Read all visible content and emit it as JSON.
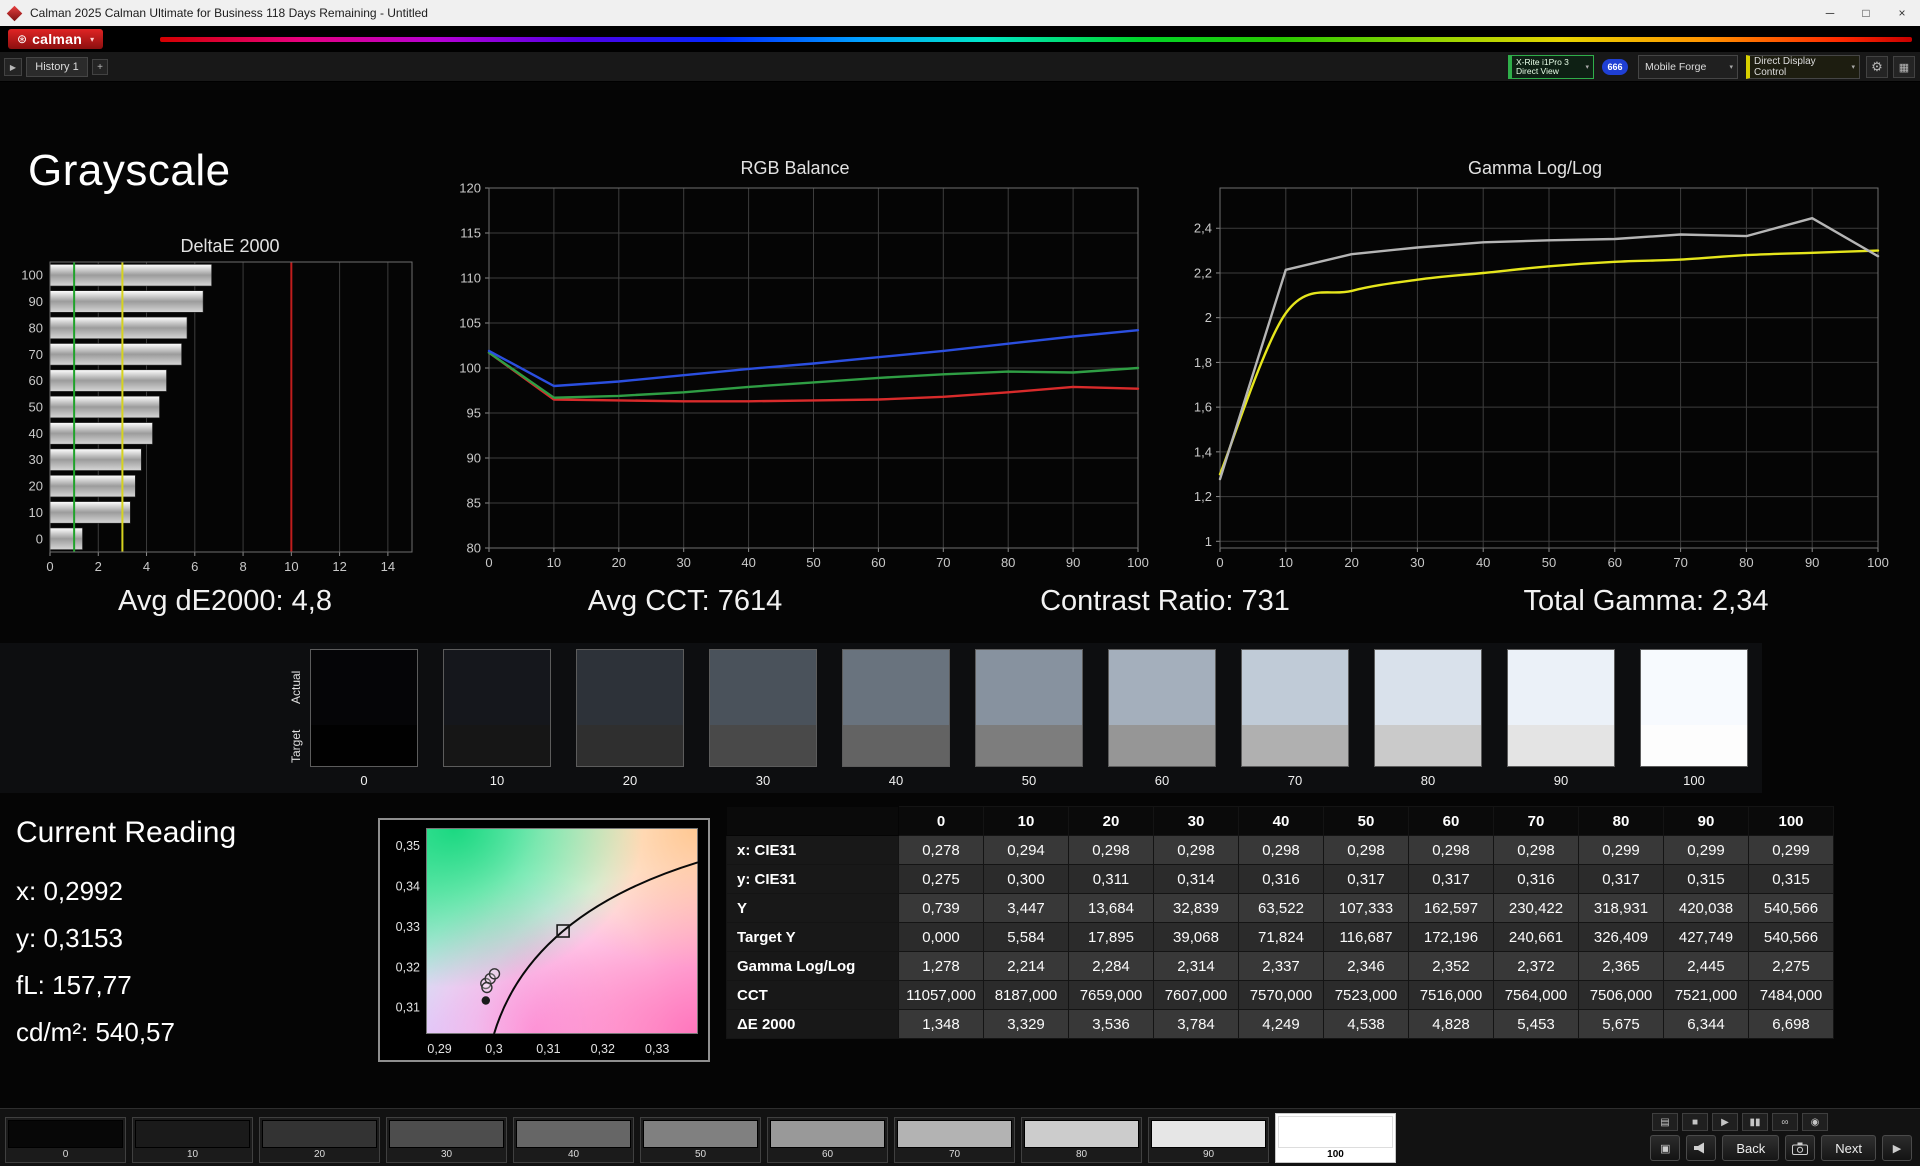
{
  "window": {
    "title": "Calman 2025 Calman Ultimate for Business 118 Days Remaining  - Untitled",
    "minimize_glyph": "─",
    "maximize_glyph": "□",
    "close_glyph": "×"
  },
  "brand": {
    "logo_text": "calman",
    "flower_glyph": "⊛",
    "caret_glyph": "▾",
    "accent_red": "#c41616"
  },
  "toolbar": {
    "expand_glyph": "▶",
    "history_tab": "History 1",
    "add_glyph": "+",
    "meter": {
      "line1": "X-Rite i1Pro 3",
      "line2": "Direct View",
      "accent": "#2fae4a"
    },
    "badge": "666",
    "badge_color": "#1f3fd4",
    "source": "Mobile Forge",
    "display_control": {
      "label": "Direct Display Control",
      "accent": "#d8d000"
    },
    "caret_glyph": "▾",
    "gear_glyph": "⚙",
    "panel_glyph": "▦"
  },
  "page": {
    "title": "Grayscale"
  },
  "summary": {
    "avg_de": "Avg dE2000: 4,8",
    "avg_cct": "Avg CCT: 7614",
    "contrast": "Contrast Ratio: 731",
    "total_gamma": "Total Gamma: 2,34"
  },
  "current_reading": {
    "title": "Current Reading",
    "items": [
      "x: 0,2992",
      "y: 0,3153",
      "fL: 157,77",
      "cd/m²: 540,57"
    ]
  },
  "swatch_strip": {
    "row_labels": [
      "Actual",
      "Target"
    ],
    "levels": [
      "0",
      "10",
      "20",
      "30",
      "40",
      "50",
      "60",
      "70",
      "80",
      "90",
      "100"
    ],
    "actual_colors": [
      "#050507",
      "#15171c",
      "#2d3239",
      "#4a525b",
      "#69737e",
      "#87929f",
      "#a4afbc",
      "#c0cbd7",
      "#d9e1eb",
      "#ebf1f8",
      "#f7fafe"
    ],
    "target_colors": [
      "#010101",
      "#161616",
      "#2f2f2f",
      "#494949",
      "#636363",
      "#7d7d7d",
      "#969696",
      "#b0b0b0",
      "#cacaca",
      "#e4e4e4",
      "#fdfdfd"
    ]
  },
  "table": {
    "columns": [
      "0",
      "10",
      "20",
      "30",
      "40",
      "50",
      "60",
      "70",
      "80",
      "90",
      "100"
    ],
    "rows": [
      {
        "label": "x: CIE31",
        "values": [
          "0,278",
          "0,294",
          "0,298",
          "0,298",
          "0,298",
          "0,298",
          "0,298",
          "0,298",
          "0,299",
          "0,299",
          "0,299"
        ]
      },
      {
        "label": "y: CIE31",
        "values": [
          "0,275",
          "0,300",
          "0,311",
          "0,314",
          "0,316",
          "0,317",
          "0,317",
          "0,316",
          "0,317",
          "0,315",
          "0,315"
        ]
      },
      {
        "label": "Y",
        "values": [
          "0,739",
          "3,447",
          "13,684",
          "32,839",
          "63,522",
          "107,333",
          "162,597",
          "230,422",
          "318,931",
          "420,038",
          "540,566"
        ]
      },
      {
        "label": "Target Y",
        "values": [
          "0,000",
          "5,584",
          "17,895",
          "39,068",
          "71,824",
          "116,687",
          "172,196",
          "240,661",
          "326,409",
          "427,749",
          "540,566"
        ]
      },
      {
        "label": "Gamma Log/Log",
        "values": [
          "1,278",
          "2,214",
          "2,284",
          "2,314",
          "2,337",
          "2,346",
          "2,352",
          "2,372",
          "2,365",
          "2,445",
          "2,275"
        ]
      },
      {
        "label": "CCT",
        "values": [
          "11057,000",
          "8187,000",
          "7659,000",
          "7607,000",
          "7570,000",
          "7523,000",
          "7516,000",
          "7564,000",
          "7506,000",
          "7521,000",
          "7484,000"
        ]
      },
      {
        "label": "ΔE 2000",
        "values": [
          "1,348",
          "3,329",
          "3,536",
          "3,784",
          "4,249",
          "4,538",
          "4,828",
          "5,453",
          "5,675",
          "6,344",
          "6,698"
        ]
      }
    ]
  },
  "pattern_bar": {
    "patches": [
      {
        "label": "0",
        "color": "#070707"
      },
      {
        "label": "10",
        "color": "#1a1a1a"
      },
      {
        "label": "20",
        "color": "#333333"
      },
      {
        "label": "30",
        "color": "#4d4d4d"
      },
      {
        "label": "40",
        "color": "#666666"
      },
      {
        "label": "50",
        "color": "#808080"
      },
      {
        "label": "60",
        "color": "#999999"
      },
      {
        "label": "70",
        "color": "#b3b3b3"
      },
      {
        "label": "80",
        "color": "#cccccc"
      },
      {
        "label": "90",
        "color": "#e6e6e6"
      },
      {
        "label": "100",
        "color": "#ffffff"
      }
    ],
    "selected": "100",
    "transport_glyphs": [
      {
        "name": "monitor-icon",
        "glyph": "▤"
      },
      {
        "name": "stop-icon",
        "glyph": "■"
      },
      {
        "name": "play-icon",
        "glyph": "▶"
      },
      {
        "name": "pause-icon",
        "glyph": "▮▮"
      },
      {
        "name": "continuous-icon",
        "glyph": "∞"
      },
      {
        "name": "eye-icon",
        "glyph": "◉"
      }
    ],
    "window_glyph": "▣",
    "advance_glyph": "▶",
    "back_label": "Back",
    "next_label": "Next"
  },
  "chart_data": [
    {
      "id": "deltae",
      "type": "bar",
      "title": "DeltaE 2000",
      "orientation": "horizontal",
      "categories": [
        "100",
        "90",
        "80",
        "70",
        "60",
        "50",
        "40",
        "30",
        "20",
        "10",
        "0"
      ],
      "values": [
        6.698,
        6.344,
        5.675,
        5.453,
        4.828,
        4.538,
        4.249,
        3.784,
        3.536,
        3.329,
        1.348
      ],
      "xlim": [
        0,
        15
      ],
      "xticks": [
        0,
        2,
        4,
        6,
        8,
        10,
        12,
        14
      ],
      "xtick_labels": [
        "0",
        "2",
        "4",
        "6",
        "8",
        "10",
        "12",
        "14"
      ],
      "reference_lines": [
        {
          "x": 1,
          "color": "#1fa32a"
        },
        {
          "x": 3,
          "color": "#d6d31f"
        },
        {
          "x": 10,
          "color": "#c01d1d"
        }
      ]
    },
    {
      "id": "rgb",
      "type": "line",
      "title": "RGB Balance",
      "x": [
        0,
        10,
        20,
        30,
        40,
        50,
        60,
        70,
        80,
        90,
        100
      ],
      "xtick_labels": [
        "0",
        "10",
        "20",
        "30",
        "40",
        "50",
        "60",
        "70",
        "80",
        "90",
        "100"
      ],
      "ylim": [
        80,
        120
      ],
      "yticks": [
        80,
        85,
        90,
        95,
        100,
        105,
        110,
        115,
        120
      ],
      "ytick_labels": [
        "80",
        "85",
        "90",
        "95",
        "100",
        "105",
        "110",
        "115",
        "120"
      ],
      "series": [
        {
          "name": "Red",
          "color": "#d92b2b",
          "values": [
            101.7,
            96.5,
            96.4,
            96.3,
            96.3,
            96.4,
            96.5,
            96.8,
            97.3,
            97.9,
            97.7
          ]
        },
        {
          "name": "Green",
          "color": "#2f9e44",
          "values": [
            101.7,
            96.7,
            96.9,
            97.3,
            97.9,
            98.4,
            98.9,
            99.3,
            99.6,
            99.5,
            100.0
          ]
        },
        {
          "name": "Blue",
          "color": "#2b4fe0",
          "values": [
            101.9,
            98.0,
            98.5,
            99.2,
            99.9,
            100.5,
            101.2,
            101.9,
            102.7,
            103.5,
            104.2
          ]
        }
      ]
    },
    {
      "id": "gamma",
      "type": "line",
      "title": "Gamma Log/Log",
      "x": [
        0,
        10,
        20,
        30,
        40,
        50,
        60,
        70,
        80,
        90,
        100
      ],
      "xtick_labels": [
        "0",
        "10",
        "20",
        "30",
        "40",
        "50",
        "60",
        "70",
        "80",
        "90",
        "100"
      ],
      "ylim": [
        0.97,
        2.58
      ],
      "yticks": [
        1,
        1.2,
        1.4,
        1.6,
        1.8,
        2,
        2.2,
        2.4
      ],
      "ytick_labels": [
        "1",
        "1,2",
        "1,4",
        "1,6",
        "1,8",
        "2",
        "2,2",
        "2,4"
      ],
      "series": [
        {
          "name": "Target",
          "color": "#e6e61c",
          "smooth": true,
          "values": [
            1.3,
            2.02,
            2.12,
            2.17,
            2.2,
            2.23,
            2.25,
            2.26,
            2.28,
            2.29,
            2.3
          ]
        },
        {
          "name": "Measured",
          "color": "#b5b5b5",
          "smooth": false,
          "values": [
            1.278,
            2.214,
            2.284,
            2.314,
            2.337,
            2.346,
            2.352,
            2.372,
            2.365,
            2.445,
            2.275
          ]
        }
      ]
    },
    {
      "id": "cie",
      "type": "scatter",
      "xlim": [
        0.2875,
        0.3375
      ],
      "ylim": [
        0.3035,
        0.3545
      ],
      "xticks": [
        0.29,
        0.3,
        0.31,
        0.32,
        0.33
      ],
      "xtick_labels": [
        "0,29",
        "0,3",
        "0,31",
        "0,32",
        "0,33"
      ],
      "yticks": [
        0.31,
        0.32,
        0.33,
        0.34,
        0.35
      ],
      "ytick_labels": [
        "0,31",
        "0,32",
        "0,33",
        "0,34",
        "0,35"
      ],
      "locus": [
        [
          0.3,
          0.3035
        ],
        [
          0.3127,
          0.329
        ],
        [
          0.3375,
          0.346
        ]
      ],
      "target": {
        "x": 0.3127,
        "y": 0.329
      },
      "points": [
        {
          "x": 0.2985,
          "y": 0.316
        },
        {
          "x": 0.2993,
          "y": 0.3172
        },
        {
          "x": 0.3001,
          "y": 0.3184
        },
        {
          "x": 0.2987,
          "y": 0.315
        }
      ],
      "current": {
        "x": 0.2985,
        "y": 0.3118
      }
    }
  ]
}
